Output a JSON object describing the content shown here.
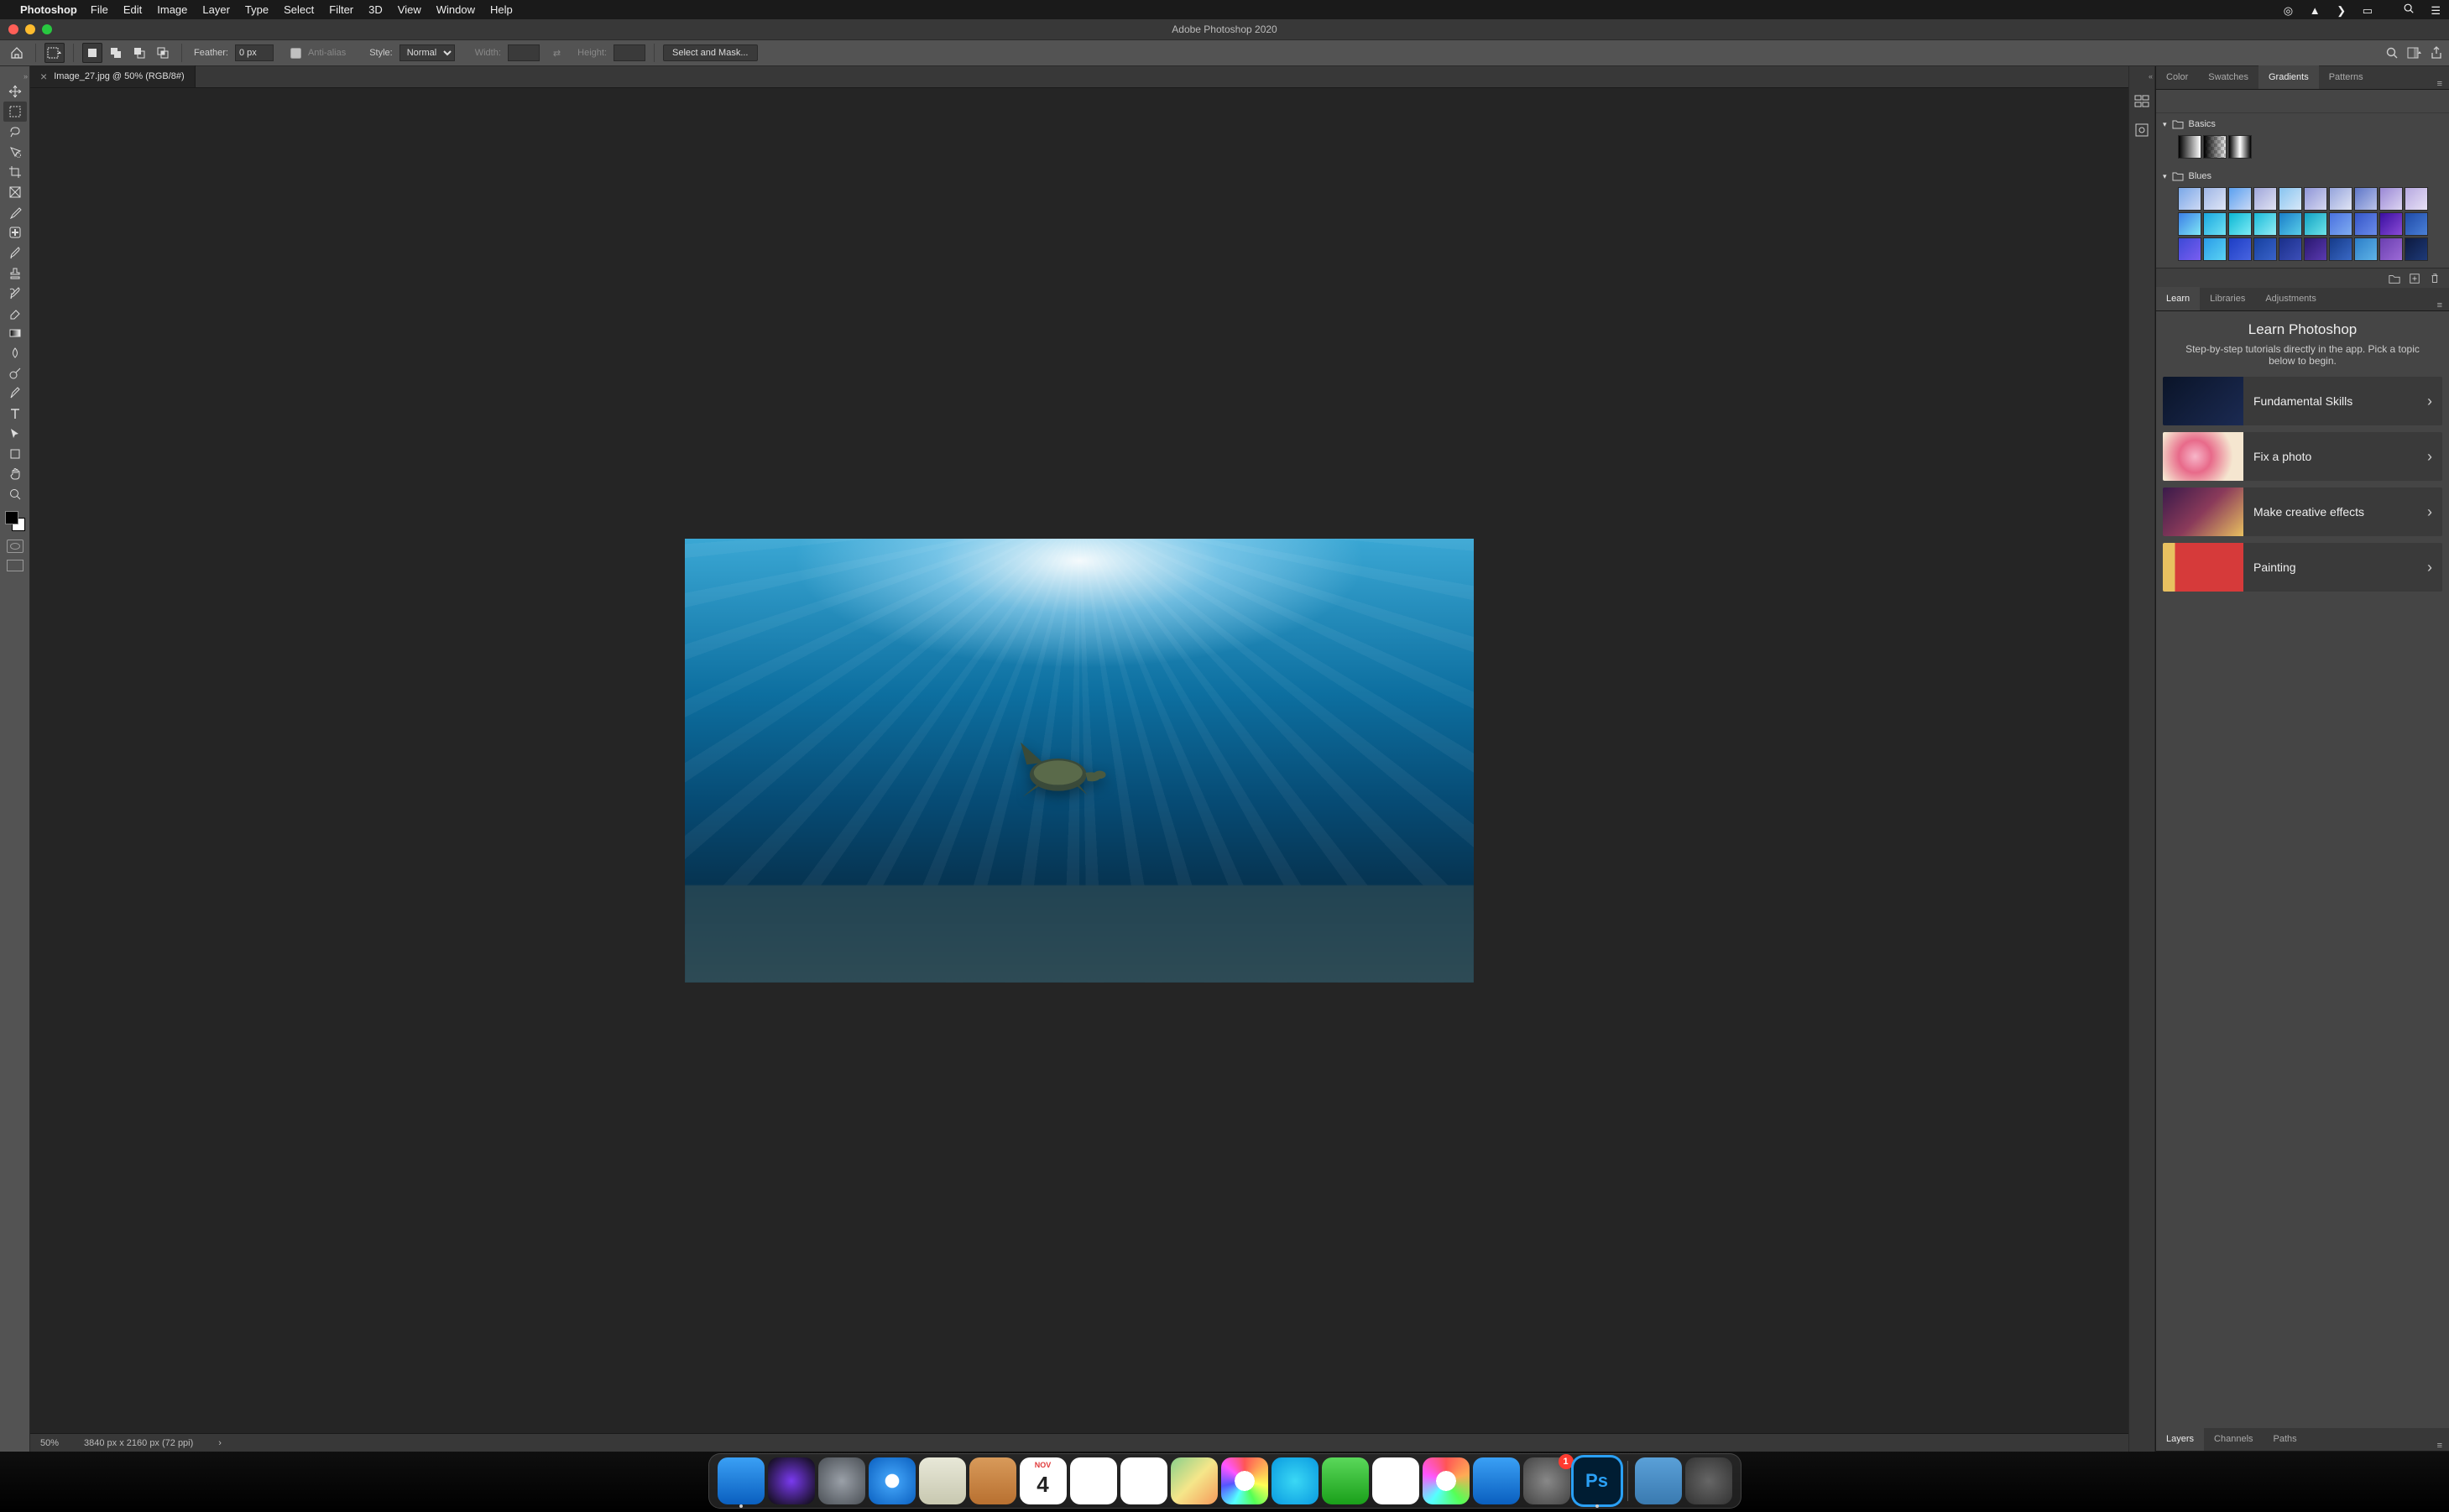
{
  "menubar": {
    "app_name": "Photoshop",
    "items": [
      "File",
      "Edit",
      "Image",
      "Layer",
      "Type",
      "Select",
      "Filter",
      "3D",
      "View",
      "Window",
      "Help"
    ]
  },
  "window": {
    "title": "Adobe Photoshop 2020"
  },
  "options_bar": {
    "feather_label": "Feather:",
    "feather_value": "0 px",
    "anti_alias_label": "Anti-alias",
    "style_label": "Style:",
    "style_value": "Normal",
    "width_label": "Width:",
    "height_label": "Height:",
    "select_mask_btn": "Select and Mask..."
  },
  "document": {
    "tab_title": "Image_27.jpg @ 50% (RGB/8#)",
    "zoom": "50%",
    "dimensions": "3840 px x 2160 px (72 ppi)"
  },
  "tools": {
    "list": [
      "move",
      "marquee",
      "lasso",
      "quick-select",
      "crop",
      "frame",
      "eyedropper",
      "healing",
      "brush",
      "stamp",
      "history-brush",
      "eraser",
      "gradient",
      "blur",
      "dodge",
      "pen",
      "type",
      "path-select",
      "shape",
      "hand",
      "zoom"
    ],
    "active": "marquee"
  },
  "right_panels": {
    "group1_tabs": [
      "Color",
      "Swatches",
      "Gradients",
      "Patterns"
    ],
    "group1_active": "Gradients",
    "gradients": {
      "groups": [
        {
          "name": "Basics",
          "swatches": [
            {
              "css": "linear-gradient(90deg,#000,#fff)"
            },
            {
              "css": "linear-gradient(90deg,#000,transparent),repeating-conic-gradient(#bbb 0 25%,#eee 0 50%) 0/8px 8px"
            },
            {
              "css": "linear-gradient(90deg,#000,#fff 50%,#000)"
            }
          ]
        },
        {
          "name": "Blues",
          "swatches": [
            {
              "css": "linear-gradient(135deg,#7aa7e8,#cdd9f4)"
            },
            {
              "css": "linear-gradient(135deg,#9fb6e6,#dfe6f7)"
            },
            {
              "css": "linear-gradient(135deg,#5aa0f0,#c8d8f5)"
            },
            {
              "css": "linear-gradient(135deg,#a0a7db,#e1e3f3)"
            },
            {
              "css": "linear-gradient(135deg,#88c4f0,#d7e8f8)"
            },
            {
              "css": "linear-gradient(135deg,#8f96d8,#d6d8f0)"
            },
            {
              "css": "linear-gradient(135deg,#95a4dc,#e0e4f4)"
            },
            {
              "css": "linear-gradient(135deg,#5f77c9,#bac3e9)"
            },
            {
              "css": "linear-gradient(135deg,#9a88d6,#dcd4f1)"
            },
            {
              "css": "linear-gradient(135deg,#b7a9e1,#e8e1f5)"
            },
            {
              "css": "linear-gradient(135deg,#3b7ee6,#7fe6f5)"
            },
            {
              "css": "linear-gradient(135deg,#1aa8e0,#6fe1f3)"
            },
            {
              "css": "linear-gradient(135deg,#0bb7d4,#7debf5)"
            },
            {
              "css": "linear-gradient(135deg,#1abbd9,#92ecf5)"
            },
            {
              "css": "linear-gradient(135deg,#1a7ec9,#59cde8)"
            },
            {
              "css": "linear-gradient(135deg,#12a2c4,#6de3e8)"
            },
            {
              "css": "linear-gradient(135deg,#4a71e0,#7facf0)"
            },
            {
              "css": "linear-gradient(135deg,#3556c9,#6a8be8)"
            },
            {
              "css": "linear-gradient(135deg,#3a0fa0,#8a4bd6)"
            },
            {
              "css": "linear-gradient(135deg,#1f4aa8,#4a80d6)"
            },
            {
              "css": "linear-gradient(135deg,#3c49d6,#7a5ef0)"
            },
            {
              "css": "linear-gradient(135deg,#2a9de8,#5bd2f3)"
            },
            {
              "css": "linear-gradient(135deg,#1d3ec4,#4864e0)"
            },
            {
              "css": "linear-gradient(135deg,#1640a0,#3a63c9)"
            },
            {
              "css": "linear-gradient(135deg,#1a2f8a,#3c4fb8)"
            },
            {
              "css": "linear-gradient(135deg,#2a1870,#5a3ab0)"
            },
            {
              "css": "linear-gradient(135deg,#153b8a,#3a68c4)"
            },
            {
              "css": "linear-gradient(135deg,#2c7fc9,#5fb3e6)"
            },
            {
              "css": "linear-gradient(135deg,#6a3fb0,#9c6ad6)"
            },
            {
              "css": "linear-gradient(135deg,#0d1a40,#1e3a78)"
            }
          ]
        }
      ]
    },
    "group2_tabs": [
      "Learn",
      "Libraries",
      "Adjustments"
    ],
    "group2_active": "Learn",
    "learn": {
      "title": "Learn Photoshop",
      "subtitle": "Step-by-step tutorials directly in the app. Pick a topic below to begin.",
      "items": [
        {
          "label": "Fundamental Skills",
          "thumb_css": "linear-gradient(135deg,#0a1428,#1b2a52)"
        },
        {
          "label": "Fix a photo",
          "thumb_css": "radial-gradient(circle at 40% 50%,#f7b6c9,#e86a8a 30%,#f5e6d0 70%)"
        },
        {
          "label": "Make creative effects",
          "thumb_css": "linear-gradient(135deg,#3a1a4a,#8a3a5a 50%,#e8c060)"
        },
        {
          "label": "Painting",
          "thumb_css": "linear-gradient(90deg,#e8c060 0 15%,#d63a3a 15% 100%)"
        }
      ]
    },
    "group3_tabs": [
      "Layers",
      "Channels",
      "Paths"
    ],
    "group3_active": "Layers"
  },
  "dock": {
    "apps": [
      {
        "name": "finder",
        "bg": "linear-gradient(#3aa0f5,#0a5fbf)",
        "running": true
      },
      {
        "name": "siri",
        "bg": "radial-gradient(circle,#7a3af0,#0a0a0a)"
      },
      {
        "name": "launchpad",
        "bg": "radial-gradient(circle,#9aa0a8,#4a4f55)"
      },
      {
        "name": "safari",
        "bg": "radial-gradient(circle,#fff 20%,#3a9af0 22%,#0a5fbf)"
      },
      {
        "name": "mail",
        "bg": "linear-gradient(#e8e8d8,#c8c8b0)"
      },
      {
        "name": "contacts",
        "bg": "linear-gradient(#d89a5a,#b87030)"
      },
      {
        "name": "calendar",
        "bg": "#fff",
        "text": "4",
        "header": "NOV"
      },
      {
        "name": "notes",
        "bg": "linear-gradient(#fff,#fff)"
      },
      {
        "name": "reminders",
        "bg": "#fff"
      },
      {
        "name": "maps",
        "bg": "linear-gradient(135deg,#8ad08a,#f5e68a 50%,#f59a5a)"
      },
      {
        "name": "photos",
        "bg": "radial-gradient(circle,#fff 30%,transparent 30%),conic-gradient(#f55,#fa5,#ff5,#5f5,#5ff,#55f,#f5f,#f55)"
      },
      {
        "name": "messages",
        "bg": "radial-gradient(circle,#3ad8f5,#0a9ae0)"
      },
      {
        "name": "facetime",
        "bg": "linear-gradient(#5ad85a,#1aa01a)"
      },
      {
        "name": "news",
        "bg": "#fff"
      },
      {
        "name": "music",
        "bg": "radial-gradient(circle,#fff 30%,transparent 30%),conic-gradient(#f55,#fa5,#5f5,#5ff,#f5f,#f55)"
      },
      {
        "name": "appstore",
        "bg": "linear-gradient(#3aa0f5,#0a5fbf)"
      },
      {
        "name": "preferences",
        "bg": "radial-gradient(circle,#888,#444)",
        "badge": "1"
      },
      {
        "name": "photoshop",
        "bg": "#001d33",
        "text": "Ps",
        "running": true,
        "highlight": true
      }
    ],
    "right_apps": [
      {
        "name": "downloads",
        "bg": "linear-gradient(#5aa0d8,#3a7ab0)"
      },
      {
        "name": "trash",
        "bg": "radial-gradient(circle,#666,#333)"
      }
    ]
  }
}
